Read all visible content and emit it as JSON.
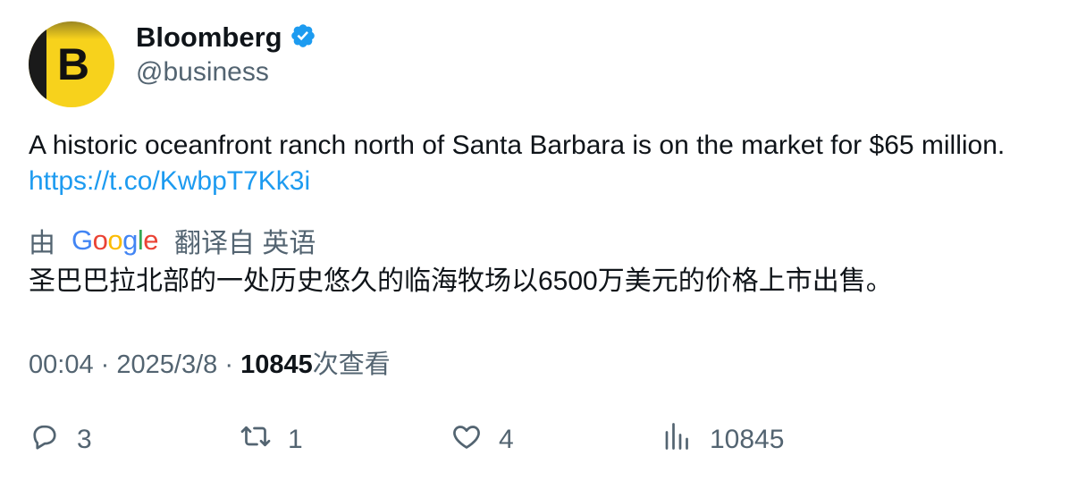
{
  "author": {
    "avatar_letter": "B",
    "display_name": "Bloomberg",
    "verified": true,
    "handle": "@business"
  },
  "tweet": {
    "text": "A historic oceanfront ranch north of Santa Barbara is on the market for $65 million.",
    "link": "https://t.co/KwbpT7Kk3i"
  },
  "translation": {
    "prefix": "由",
    "provider": "Google",
    "suffix": "翻译自 英语",
    "text": "圣巴巴拉北部的一处历史悠久的临海牧场以6500万美元的价格上市出售。"
  },
  "meta": {
    "time": "00:04",
    "separator": "·",
    "date": "2025/3/8",
    "views_count": "10845",
    "views_label": "次查看"
  },
  "actions": {
    "replies": "3",
    "retweets": "1",
    "likes": "4",
    "views": "10845"
  },
  "colors": {
    "link": "#1d9bf0",
    "verified": "#1d9bf0",
    "secondary_text": "#536471",
    "avatar_bg": "#f7d21c"
  },
  "icons": [
    "verified-badge-icon",
    "reply-icon",
    "retweet-icon",
    "like-icon",
    "views-icon"
  ]
}
